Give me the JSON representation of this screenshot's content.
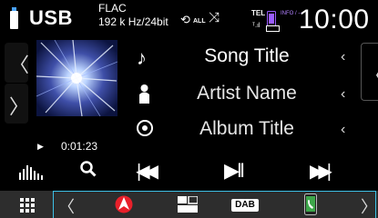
{
  "status_bar": {
    "source": "USB",
    "format_line1": "FLAC",
    "format_line2": "192 k Hz/24bit",
    "repeat_mode": "ALL",
    "tel_label": "TEL",
    "phone_status": "INFO / ---",
    "clock": "10:00"
  },
  "track": {
    "title": "Song Title",
    "artist": "Artist Name",
    "album": "Album Title",
    "elapsed": "0:01:23"
  },
  "glyphs": {
    "left_arrow": "〈",
    "right_arrow": "〉",
    "row_caret": "‹",
    "play_marker": "▶",
    "prev": "|◀◀",
    "playpause": "▶II",
    "next": "▶▶|",
    "note": "♪"
  },
  "shortcuts": {
    "items": [
      "navigation-icon",
      "split-screen-icon",
      "dab-icon",
      "phone-app-icon"
    ],
    "dab_label": "DAB"
  },
  "colors": {
    "accent": "#3cc0e6",
    "nav_red": "#e8202a",
    "phone_green": "#3da64a",
    "purple": "#9a5cff"
  }
}
